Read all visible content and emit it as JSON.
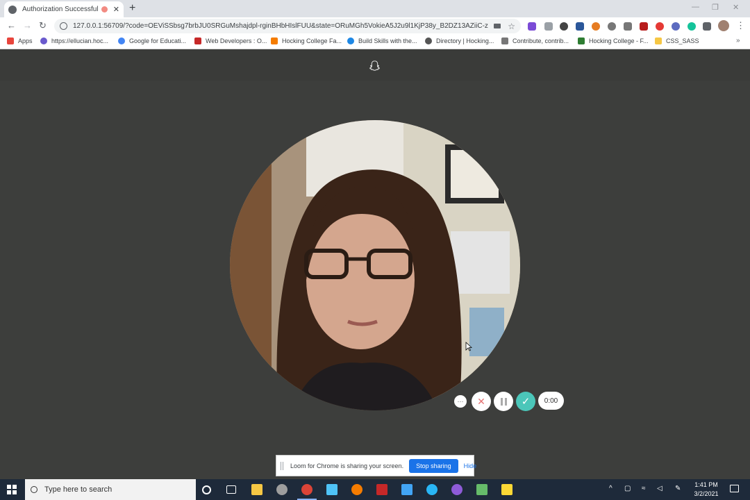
{
  "browser": {
    "tab_title": "Authorization Successful",
    "tab_close": "✕",
    "new_tab": "+",
    "url": "127.0.0.1:56709/?code=OEViSSbsg7brbJU0SRGuMshajdpl-rginBHbHIslFUU&state=ORuMGh5VokieA5J2u9l1KjP38y_B2DZ13AZiiC-z6...",
    "back": "←",
    "forward": "→",
    "reload": "↻",
    "star": "☆",
    "menu": "⋮"
  },
  "bookmarks": [
    {
      "label": "Apps",
      "color": "#e8453c"
    },
    {
      "label": "https://ellucian.hoc...",
      "color": "#6a5acd"
    },
    {
      "label": "Google for Educati...",
      "color": "#4285f4"
    },
    {
      "label": "Web Developers : O...",
      "color": "#c62828"
    },
    {
      "label": "Hocking College Fa...",
      "color": "#f57c00"
    },
    {
      "label": "Build Skills with the...",
      "color": "#1e88e5"
    },
    {
      "label": "Directory | Hocking...",
      "color": "#555555"
    },
    {
      "label": "Contribute, contrib...",
      "color": "#777777"
    },
    {
      "label": "Hocking College - F...",
      "color": "#2e7d32"
    },
    {
      "label": "CSS_SASS",
      "color": "#f6c744"
    }
  ],
  "bookmarks_more": "»",
  "recorder": {
    "more": "···",
    "cancel": "✕",
    "done": "✓",
    "timer": "0:00"
  },
  "share": {
    "message": "Loom for Chrome is sharing your screen.",
    "stop": "Stop sharing",
    "hide": "Hide"
  },
  "taskbar": {
    "search_placeholder": "Type here to search",
    "time": "1:41 PM",
    "date": "3/2/2021"
  },
  "colors": {
    "page_bg": "#3d3e3c",
    "accent_done": "#4bc6b9",
    "share_button": "#1a73e8"
  }
}
